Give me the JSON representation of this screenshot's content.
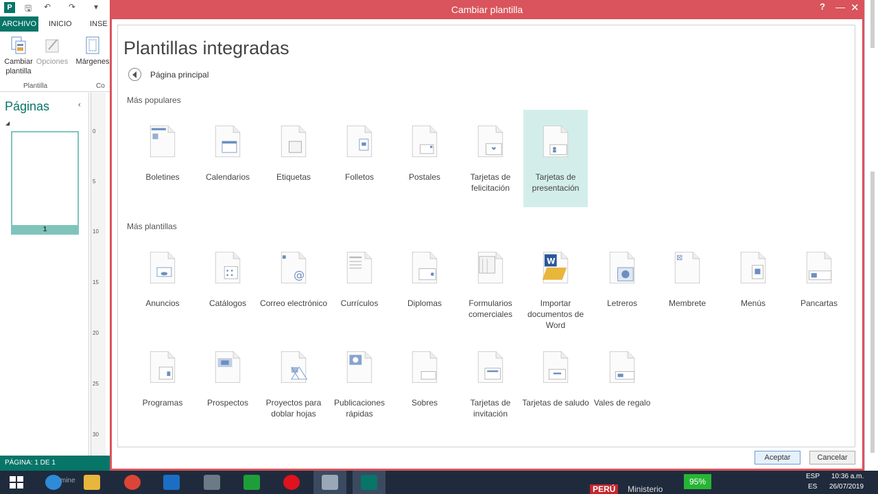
{
  "app": {
    "qat_icons": [
      "publisher-icon",
      "save-icon",
      "undo-icon",
      "redo-icon",
      "customize-icon"
    ],
    "tabs": {
      "archivo": "ARCHIVO",
      "inicio": "INICIO",
      "insertar": "INSE"
    },
    "ribbon": {
      "cambiar": "Cambiar plantilla",
      "opciones": "Opciones",
      "margenes": "Márgenes",
      "group_plantilla": "Plantilla",
      "group_con": "Co"
    },
    "pages_title": "Páginas",
    "page_number": "1",
    "ruler_labels": [
      "0",
      "5",
      "10",
      "15",
      "20",
      "25",
      "30"
    ],
    "status": "PÁGINA: 1 DE 1"
  },
  "dialog": {
    "title": "Cambiar plantilla",
    "help": "?",
    "heading": "Plantillas integradas",
    "back_label": "Página principal",
    "section_popular": "Más populares",
    "section_more": "Más plantillas",
    "popular": [
      {
        "label": "Boletines",
        "icon": "newsletter-icon"
      },
      {
        "label": "Calendarios",
        "icon": "calendar-icon"
      },
      {
        "label": "Etiquetas",
        "icon": "labels-icon"
      },
      {
        "label": "Folletos",
        "icon": "brochure-icon"
      },
      {
        "label": "Postales",
        "icon": "postcard-icon"
      },
      {
        "label": "Tarjetas de felicitación",
        "icon": "greeting-card-icon"
      },
      {
        "label": "Tarjetas de presentación",
        "icon": "business-card-icon",
        "selected": true
      }
    ],
    "more_row1": [
      {
        "label": "Anuncios",
        "icon": "ads-icon"
      },
      {
        "label": "Catálogos",
        "icon": "catalog-icon"
      },
      {
        "label": "Correo electrónico",
        "icon": "email-icon"
      },
      {
        "label": "Currículos",
        "icon": "resume-icon"
      },
      {
        "label": "Diplomas",
        "icon": "diploma-icon"
      },
      {
        "label": "Formularios comerciales",
        "icon": "business-form-icon"
      },
      {
        "label": "Importar documentos de Word",
        "icon": "word-import-icon"
      },
      {
        "label": "Letreros",
        "icon": "sign-icon"
      },
      {
        "label": "Membrete",
        "icon": "letterhead-icon"
      },
      {
        "label": "Menús",
        "icon": "menu-icon"
      },
      {
        "label": "Pancartas",
        "icon": "banner-icon"
      }
    ],
    "more_row2": [
      {
        "label": "Programas",
        "icon": "program-icon"
      },
      {
        "label": "Prospectos",
        "icon": "flyer-icon"
      },
      {
        "label": "Proyectos para doblar hojas",
        "icon": "paper-fold-icon"
      },
      {
        "label": "Publicaciones rápidas",
        "icon": "quick-publication-icon"
      },
      {
        "label": "Sobres",
        "icon": "envelope-icon"
      },
      {
        "label": "Tarjetas de invitación",
        "icon": "invitation-icon"
      },
      {
        "label": "Tarjetas de saludo",
        "icon": "greeting-icon"
      },
      {
        "label": "Vales de regalo",
        "icon": "gift-certificate-icon"
      }
    ],
    "accept": "Aceptar",
    "cancel": "Cancelar"
  },
  "taskbar": {
    "battery": "95%",
    "lang_top": "ESP",
    "lang_bottom": "ES",
    "time": "10:36 a.m.",
    "date": "26/07/2019",
    "search_hint": "mine",
    "peru": "PERÚ",
    "ministerio": "Ministerio"
  },
  "colors": {
    "accent": "#077568",
    "dialog_frame": "#d9545c",
    "selected_tile": "#d3eeea",
    "icon_blue": "#6b8fc1"
  }
}
